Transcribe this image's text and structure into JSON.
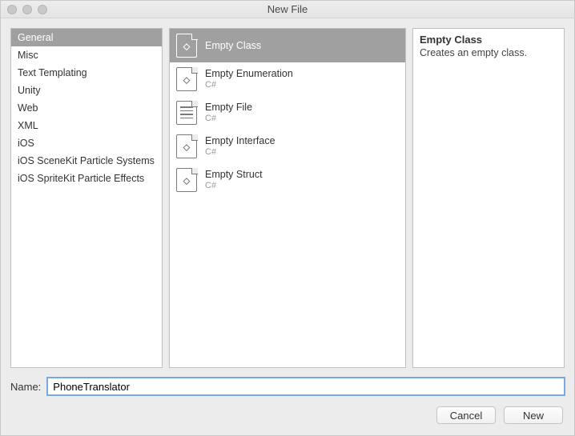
{
  "window": {
    "title": "New File"
  },
  "categories": [
    {
      "label": "General",
      "selected": true
    },
    {
      "label": "Misc"
    },
    {
      "label": "Text Templating"
    },
    {
      "label": "Unity"
    },
    {
      "label": "Web"
    },
    {
      "label": "XML"
    },
    {
      "label": "iOS"
    },
    {
      "label": "iOS SceneKit Particle Systems"
    },
    {
      "label": "iOS SpriteKit Particle Effects"
    }
  ],
  "templates": [
    {
      "label": "Empty Class",
      "sub": "",
      "icon": "diamond",
      "selected": true
    },
    {
      "label": "Empty Enumeration",
      "sub": "C#",
      "icon": "diamond"
    },
    {
      "label": "Empty File",
      "sub": "C#",
      "icon": "lines"
    },
    {
      "label": "Empty Interface",
      "sub": "C#",
      "icon": "diamond"
    },
    {
      "label": "Empty Struct",
      "sub": "C#",
      "icon": "diamond"
    }
  ],
  "description": {
    "title": "Empty Class",
    "body": "Creates an empty class."
  },
  "nameField": {
    "label": "Name:",
    "value": "PhoneTranslator"
  },
  "buttons": {
    "cancel": "Cancel",
    "create": "New"
  }
}
